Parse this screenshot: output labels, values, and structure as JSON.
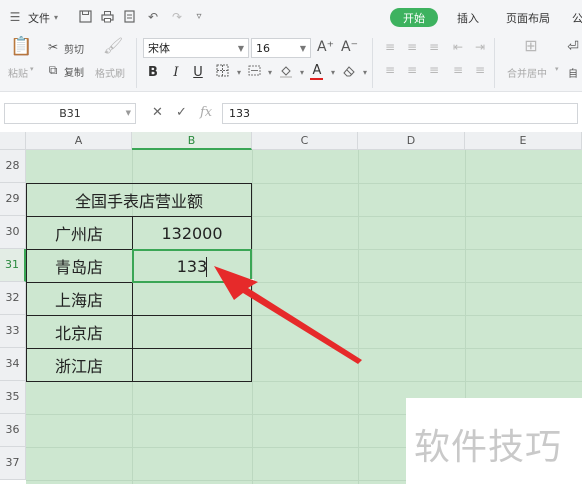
{
  "menubar": {
    "file_label": "文件",
    "tabs": [
      {
        "label": "开始",
        "active": true
      },
      {
        "label": "插入",
        "active": false
      },
      {
        "label": "页面布局",
        "active": false
      },
      {
        "label": "公",
        "active": false
      }
    ]
  },
  "ribbon": {
    "paste_label": "粘贴",
    "cut_label": "剪切",
    "copy_label": "复制",
    "format_painter_label": "格式刷",
    "font_name": "宋体",
    "font_size": "16",
    "merge_label": "合并居中",
    "auto_wrap_label": "自",
    "font_color": "#e02020"
  },
  "formula_bar": {
    "cell_reference": "B31",
    "fx_symbol": "fx",
    "value": "133"
  },
  "columns": [
    "A",
    "B",
    "C",
    "D",
    "E"
  ],
  "rows": [
    "28",
    "29",
    "30",
    "31",
    "32",
    "33",
    "34",
    "35",
    "36",
    "37"
  ],
  "active_cell": {
    "column": "B",
    "row": "31"
  },
  "table": {
    "title": "全国手表店营业额",
    "stores": [
      {
        "name": "广州店",
        "value": "132000"
      },
      {
        "name": "青岛店",
        "value": "133"
      },
      {
        "name": "上海店",
        "value": ""
      },
      {
        "name": "北京店",
        "value": ""
      },
      {
        "name": "浙江店",
        "value": ""
      }
    ]
  },
  "colors": {
    "accent": "#3db25f",
    "sheet_background": "#cde7d0",
    "arrow": "#e62a2a"
  },
  "watermark": "软件技巧"
}
